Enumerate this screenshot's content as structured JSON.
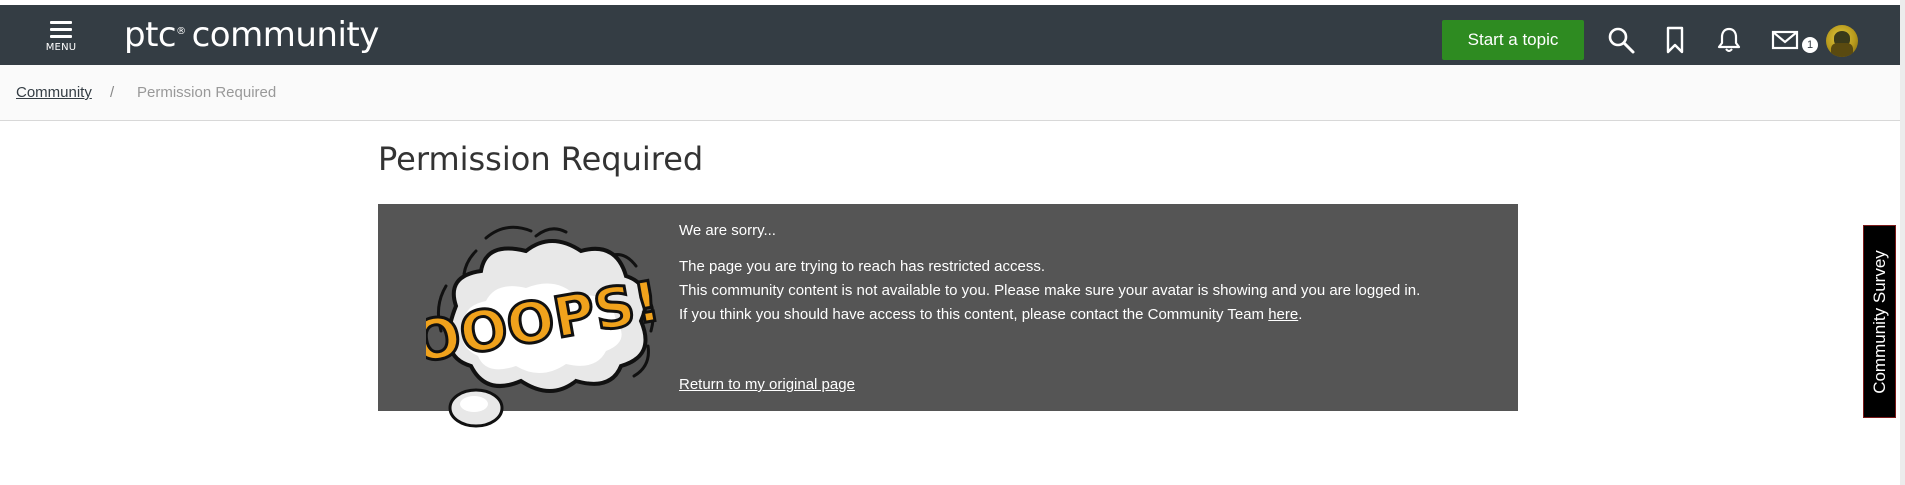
{
  "navbar": {
    "menu_label": "MENU",
    "logo_main": "ptc",
    "logo_reg": "®",
    "logo_rest": "community",
    "start_topic_label": "Start a topic",
    "icons": [
      "menu-icon",
      "search-icon",
      "bookmark-icon",
      "bell-icon",
      "mail-icon",
      "avatar"
    ],
    "mail_badge_count": "1",
    "background_color": "#343d44",
    "accent_color": "#2e8b21"
  },
  "breadcrumb": {
    "root": "Community",
    "separator": "/",
    "current": "Permission Required"
  },
  "page": {
    "title": "Permission Required"
  },
  "error_box": {
    "image_label": "OOOPS!",
    "sorry": "We are sorry...",
    "line1": "The page you are trying to reach has restricted access.",
    "line2": "This community content is not available to you. Please make sure your avatar is showing and you are logged in.",
    "line3_prefix": "If you think you should have access to this content, please contact the Community Team ",
    "line3_link": "here",
    "line3_suffix": ".",
    "return_link": "Return to my original page",
    "background_color": "#555555"
  },
  "survey_tab": {
    "label": "Community Survey"
  }
}
